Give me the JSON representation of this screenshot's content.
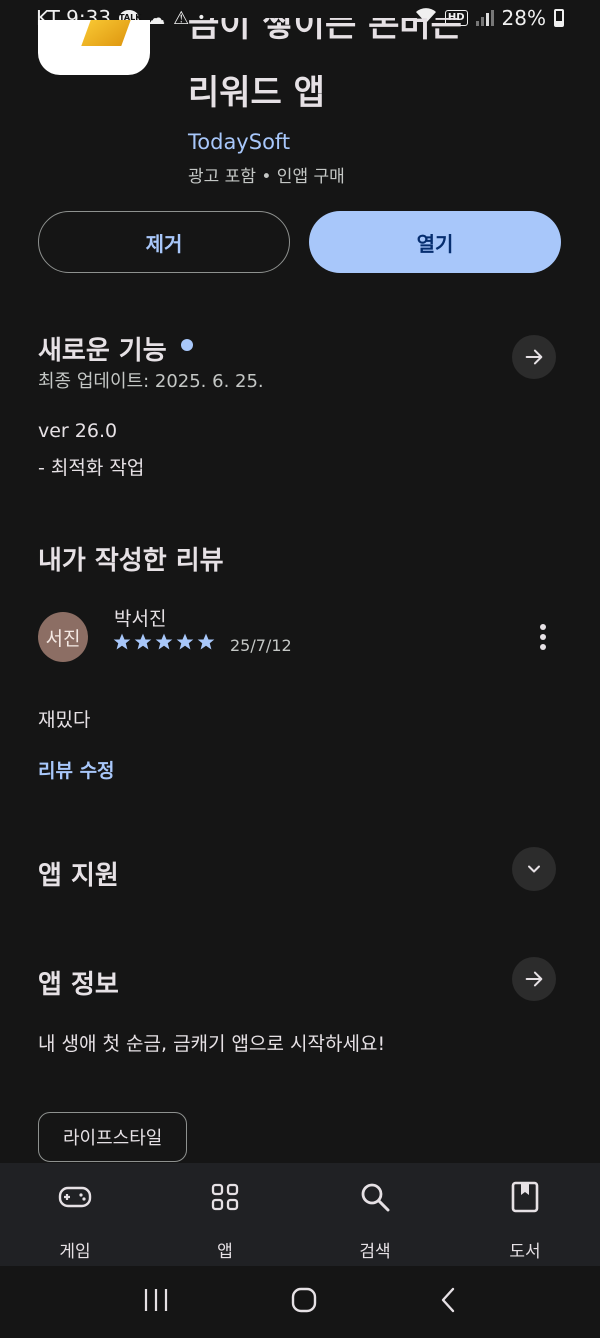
{
  "status_bar": {
    "carrier_time": "KT 9:33",
    "talk_badge": "TALK",
    "hd_badge": "HD",
    "battery": "28%"
  },
  "app": {
    "title_line1": "금이 쌓이는 돈버는",
    "title_line2": "리워드 앱",
    "developer": "TodaySoft",
    "meta": "광고 포함 • 인앱 구매"
  },
  "actions": {
    "uninstall": "제거",
    "open": "열기"
  },
  "whats_new": {
    "title": "새로운 기능",
    "last_updated": "최종 업데이트: 2025. 6. 25.",
    "version": "ver 26.0",
    "notes": "- 최적화 작업"
  },
  "my_review": {
    "title": "내가 작성한 리뷰",
    "avatar_text": "서진",
    "reviewer": "박서진",
    "rating": 5,
    "date": "25/7/12",
    "text": "재밌다",
    "edit_link": "리뷰 수정"
  },
  "app_support": {
    "title": "앱 지원"
  },
  "app_info": {
    "title": "앱 정보",
    "description": "내 생애 첫 순금, 금캐기 앱으로 시작하세요!",
    "category_chip": "라이프스타일"
  },
  "bottom_nav": [
    {
      "label": "게임",
      "icon": "gamepad-icon"
    },
    {
      "label": "앱",
      "icon": "apps-grid-icon"
    },
    {
      "label": "검색",
      "icon": "search-icon"
    },
    {
      "label": "도서",
      "icon": "book-icon"
    }
  ],
  "colors": {
    "background": "#151515",
    "accent": "#a8c7fa",
    "open_button_text": "#062e6f",
    "avatar": "#8c6e64"
  }
}
